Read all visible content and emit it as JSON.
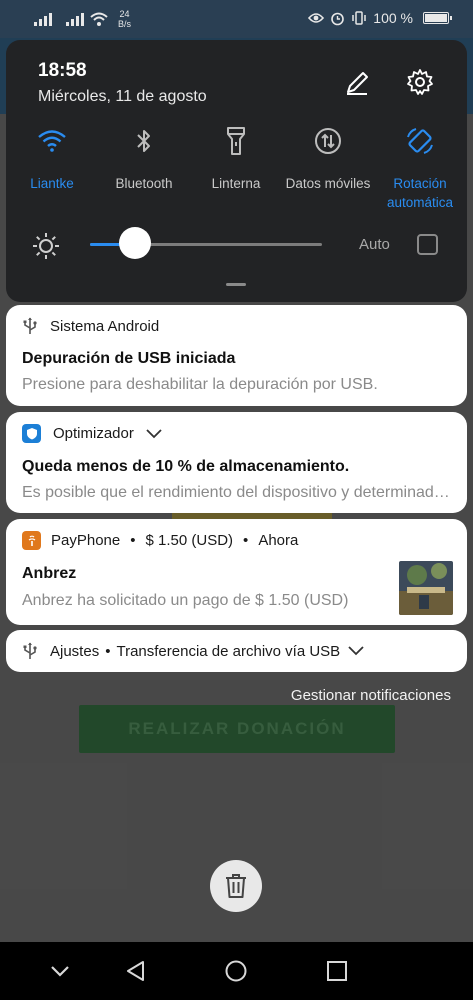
{
  "status_bar": {
    "net_speed_value": "24",
    "net_speed_unit": "B/s",
    "battery": "100 %",
    "icons": [
      "signal-icon",
      "signal-icon",
      "wifi-icon",
      "eye-icon",
      "alarm-icon",
      "vibrate-icon",
      "battery-icon"
    ]
  },
  "quick_settings": {
    "time": "18:58",
    "date": "Miércoles, 11 de agosto",
    "accent_color": "#2a8cf0",
    "tiles": [
      {
        "label": "Liantke",
        "icon": "wifi-icon",
        "active": true
      },
      {
        "label": "Bluetooth",
        "icon": "bluetooth-icon",
        "active": false
      },
      {
        "label": "Linterna",
        "icon": "flashlight-icon",
        "active": false
      },
      {
        "label": "Datos móviles",
        "icon": "mobile-data-icon",
        "active": false
      },
      {
        "label": "Rotación automática",
        "label_line1": "Rotación",
        "label_line2": "automática",
        "icon": "rotation-icon",
        "active": true
      }
    ],
    "brightness_level": 0.17,
    "auto_label": "Auto"
  },
  "notifications": [
    {
      "app": "Sistema Android",
      "title": "Depuración de USB iniciada",
      "body": "Presione para deshabilitar la depuración por USB."
    },
    {
      "app": "Optimizador",
      "title": "Queda menos de 10 % de almacenamiento.",
      "body": "Es posible que el rendimiento del dispositivo y determinadas funciones se vean afectados."
    },
    {
      "app": "PayPhone",
      "sep1": "•",
      "amount": "$ 1.50 (USD)",
      "sep2": "•",
      "time": "Ahora",
      "title": "Anbrez",
      "body": "Anbrez ha solicitado un pago de $ 1.50 (USD)"
    },
    {
      "app": "Ajustes",
      "sep": "•",
      "title": "Transferencia de archivo vía USB"
    }
  ],
  "manage_label": "Gestionar notificaciones",
  "background_app": {
    "button_label": "REALIZAR DONACIÓN"
  }
}
